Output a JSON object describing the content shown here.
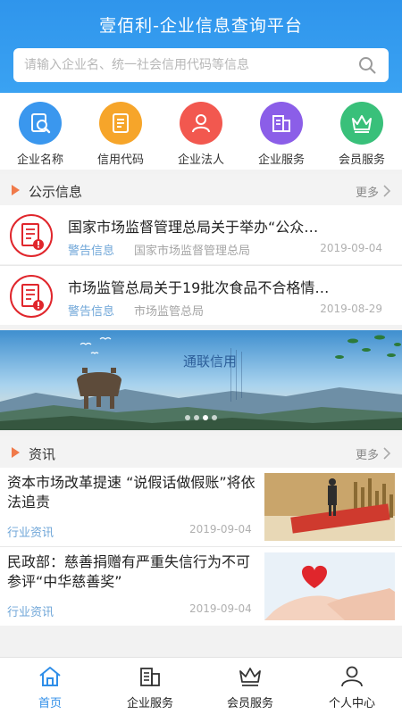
{
  "header": {
    "title": "壹佰利-企业信息查询平台",
    "search_placeholder": "请输入企业名、统一社会信用代码等信息"
  },
  "quick_menu": [
    {
      "label": "企业名称",
      "icon": "company-search-icon",
      "color": "#3a97ee"
    },
    {
      "label": "信用代码",
      "icon": "credit-code-icon",
      "color": "#f6a52a"
    },
    {
      "label": "企业法人",
      "icon": "legal-person-icon",
      "color": "#f2584f"
    },
    {
      "label": "企业服务",
      "icon": "enterprise-service-icon",
      "color": "#8b5ee8"
    },
    {
      "label": "会员服务",
      "icon": "crown-icon",
      "color": "#39c07a"
    }
  ],
  "notices_section": {
    "title": "公示信息",
    "more": "更多"
  },
  "notices": [
    {
      "title": "国家市场监督管理总局关于举办“公众…",
      "tag": "警告信息",
      "source": "国家市场监督管理总局",
      "date": "2019-09-04"
    },
    {
      "title": "市场监管总局关于19批次食品不合格情…",
      "tag": "警告信息",
      "source": "市场监管总局",
      "date": "2019-08-29"
    }
  ],
  "banner": {
    "caption": "通联信用",
    "dots": 4,
    "active_dot": 2
  },
  "news_section": {
    "title": "资讯",
    "more": "更多"
  },
  "news": [
    {
      "title": "资本市场改革提速 “说假话做假账”将依法追责",
      "category": "行业资讯",
      "date": "2019-09-04"
    },
    {
      "title": "民政部：慈善捐赠有严重失信行为不可参评“中华慈善奖”",
      "category": "行业资讯",
      "date": "2019-09-04"
    }
  ],
  "tabbar": [
    {
      "label": "首页",
      "icon": "home-icon",
      "active": true
    },
    {
      "label": "企业服务",
      "icon": "enterprise-service-icon",
      "active": false
    },
    {
      "label": "会员服务",
      "icon": "crown-icon",
      "active": false
    },
    {
      "label": "个人中心",
      "icon": "person-icon",
      "active": false
    }
  ],
  "colors": {
    "primary": "#2f95ec",
    "accent": "#f07a4a",
    "tag": "#6fa6d8",
    "alert": "#e0262c"
  }
}
